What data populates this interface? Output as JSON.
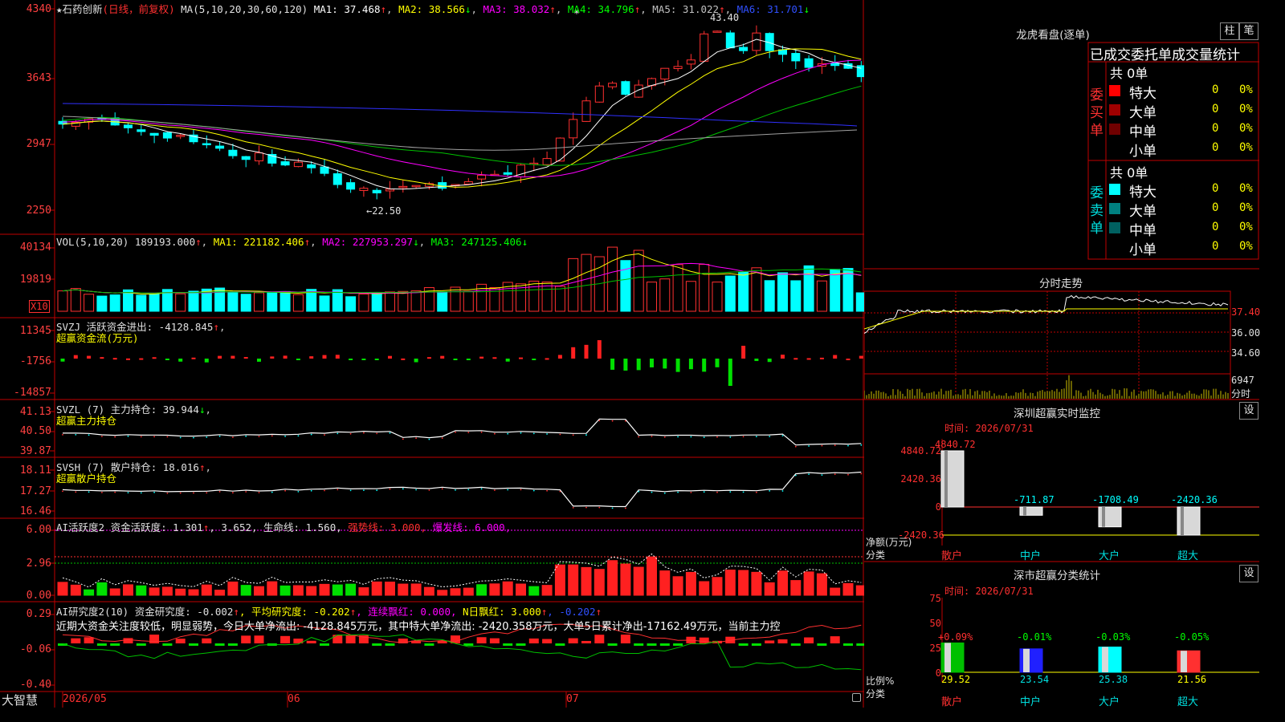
{
  "app": {
    "name": "大智慧"
  },
  "stock": {
    "star": "★",
    "name": "石药创新",
    "mode": "(日线，前复权)"
  },
  "main_chart": {
    "ma_header": {
      "label": "MA(5,10,20,30,60,120)",
      "ma1": "MA1: 37.468",
      "ma2": "MA2: 38.566",
      "ma3": "MA3: 38.032",
      "ma4": "MA4: 34.796",
      "ma5": "MA5: 31.022",
      "ma6": "MA6: 31.701"
    },
    "y_labels": [
      "4340",
      "3643",
      "2947",
      "2250"
    ],
    "high_label": "43.40",
    "low_label": "22.50",
    "colors": {
      "ma1": "#ffffff",
      "ma2": "#ffff00",
      "ma3": "#ff00ff",
      "ma4": "#00c000",
      "ma5": "#a0a0a0",
      "ma6": "#3030ff",
      "up": "#ff3030",
      "down": "#00ffff"
    }
  },
  "vol_chart": {
    "header": "VOL(5,10,20)",
    "value": "189193.000",
    "ma1": "MA1: 221182.406",
    "ma2": "MA2: 227953.297",
    "ma3": "MA3: 247125.406",
    "y_labels": [
      "40134",
      "19819"
    ],
    "unit": "X10"
  },
  "svzj": {
    "header": "SVZJ  活跃资金进出: -4128.845",
    "sub": "超赢资金流(万元)",
    "y_labels": [
      "11345",
      "-1756",
      "-14857"
    ]
  },
  "svzl": {
    "header": "SVZL (7) 主力持仓: 39.944",
    "sub": "超赢主力持仓",
    "y_labels": [
      "41.13",
      "40.50",
      "39.87"
    ]
  },
  "svsh": {
    "header": "SVSH (7) 散户持仓: 18.016",
    "sub": "超赢散户持仓",
    "y_labels": [
      "18.11",
      "17.27",
      "16.46"
    ]
  },
  "ai_active": {
    "header_a": "AI活跃度2 资金活跃度: 1.301",
    "header_b": ", 3.652, 生命线: 1.560,",
    "strong": " 强势线: 3.000,",
    "burst": " 爆发线: 6.000,",
    "y_labels": [
      "6.00",
      "2.96",
      "0.00"
    ]
  },
  "ai_research": {
    "header_a": "AI研究度2(10) 资金研究度: -0.002",
    "avg": ", 平均研究度: -0.202",
    "lianxu": ", 连续飘红: 0.000,",
    "nday": " N日飘红: 3.000",
    "tail": ", -0.202",
    "comment": "近期大资金关注度较低，明显弱势，今日大单净流出: -4128.845万元，其中特大单净流出: -2420.358万元，大单5日累计净出-17162.49万元，当前主力控",
    "y_labels": [
      "0.29",
      "-0.06",
      "-0.40"
    ]
  },
  "x_axis": {
    "labels": [
      "2026/05",
      "06",
      "07"
    ]
  },
  "dragon_tiger": {
    "title": "龙虎看盘(逐单)",
    "btn_zhu": "柱",
    "btn_bi": "笔",
    "header": "已成交委托单成交量统计",
    "buy_label": "委买单",
    "sell_label": "委卖单",
    "buy_total": "共 0单",
    "sell_total": "共 0单",
    "buy_rows": [
      {
        "label": "特大",
        "count": "0",
        "pct": "0%",
        "color": "#ff0000"
      },
      {
        "label": "大单",
        "count": "0",
        "pct": "0%",
        "color": "#a00000"
      },
      {
        "label": "中单",
        "count": "0",
        "pct": "0%",
        "color": "#700000"
      },
      {
        "label": "小单",
        "count": "0",
        "pct": "0%",
        "color": ""
      }
    ],
    "sell_rows": [
      {
        "label": "特大",
        "count": "0",
        "pct": "0%",
        "color": "#00ffff"
      },
      {
        "label": "大单",
        "count": "0",
        "pct": "0%",
        "color": "#008080"
      },
      {
        "label": "中单",
        "count": "0",
        "pct": "0%",
        "color": "#006060"
      },
      {
        "label": "小单",
        "count": "0",
        "pct": "0%",
        "color": ""
      }
    ]
  },
  "intraday": {
    "title": "分时走势",
    "y_labels": [
      "37.40",
      "36.00",
      "34.60"
    ],
    "vol_label": "6947",
    "vol_unit": "分时"
  },
  "sz_monitor": {
    "title": "深圳超赢实时监控",
    "btn": "设",
    "time": "时间: 2026/07/31",
    "y_labels": [
      "4840.72",
      "2420.36",
      "0",
      "-2420.36"
    ],
    "axis_title": "净额(万元)",
    "cat_title": "分类",
    "bars": [
      {
        "cat": "散户",
        "value": 4840.72,
        "label": "4840.72",
        "color": "#e0e0e0",
        "lcolor": "#ff3030"
      },
      {
        "cat": "中户",
        "value": -711.87,
        "label": "-711.87",
        "color": "#e0e0e0",
        "lcolor": "#00ffff"
      },
      {
        "cat": "大户",
        "value": -1708.49,
        "label": "-1708.49",
        "color": "#e0e0e0",
        "lcolor": "#00ffff"
      },
      {
        "cat": "超大",
        "value": -2420.36,
        "label": "-2420.36",
        "color": "#e0e0e0",
        "lcolor": "#00ffff"
      }
    ]
  },
  "sz_stats": {
    "title": "深市超赢分类统计",
    "btn": "设",
    "time": "时间: 2026/07/31",
    "y_labels": [
      "75",
      "50",
      "25",
      "0"
    ],
    "axis_title": "比例%",
    "cat_title": "分类",
    "bars": [
      {
        "cat": "散户",
        "value": 29.52,
        "label": "29.52",
        "change": "+0.09%",
        "color": "#00c000",
        "ccolor": "#ff3030"
      },
      {
        "cat": "中户",
        "value": 23.54,
        "label": "23.54",
        "change": "-0.01%",
        "color": "#2020ff",
        "ccolor": "#00ff00"
      },
      {
        "cat": "大户",
        "value": 25.38,
        "label": "25.38",
        "change": "-0.03%",
        "color": "#00ffff",
        "ccolor": "#00ff00"
      },
      {
        "cat": "超大",
        "value": 21.56,
        "label": "21.56",
        "change": "-0.05%",
        "color": "#ff3030",
        "ccolor": "#00ff00"
      }
    ]
  }
}
